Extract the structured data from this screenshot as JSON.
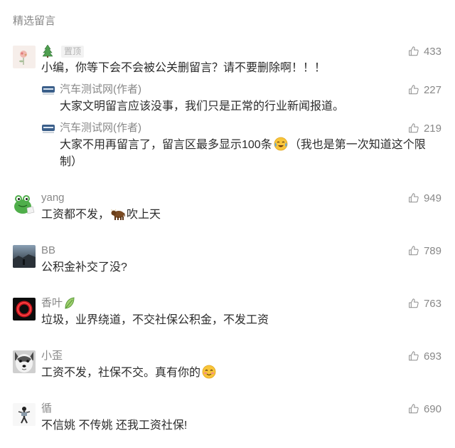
{
  "section_title": "精选留言",
  "icons": {
    "like": "thumbs-up-icon",
    "pinned_user_name": "evergreen-tree-icon",
    "name_decoration": "leaf-icon"
  },
  "colors": {
    "text": "#2b2b2b",
    "meta": "#888888",
    "badge_bg": "#f2f2f2",
    "badge_text": "#b2b2b2"
  },
  "comments": [
    {
      "name_icon": "evergreen-tree-icon",
      "badge": "置顶",
      "likes": 433,
      "text": "小编，你等下会不会被公关删留言？请不要删除啊！！！",
      "replies": [
        {
          "name": "汽车测试网(作者)",
          "likes": 227,
          "text": "大家文明留言应该没事，我们只是正常的行业新闻报道。"
        },
        {
          "name": "汽车测试网(作者)",
          "likes": 219,
          "text_before": "大家不用再留言了，留言区最多显示100条",
          "emoji": "crying-face-emoji-icon",
          "text_after": "（我也是第一次知道这个限制）"
        }
      ]
    },
    {
      "name": "yang",
      "likes": 949,
      "text_before": "工资都不发，",
      "emoji": "bull-emoji-icon",
      "text_after": "吹上天"
    },
    {
      "name": "BB",
      "likes": 789,
      "text": "公积金补交了没?"
    },
    {
      "name": "香叶",
      "name_icon": "leaf-icon",
      "likes": 763,
      "text": "垃圾，业界绕道，不交社保公积金，不发工资"
    },
    {
      "name": "小歪",
      "likes": 693,
      "text_before": "工资不发，社保不交。真有你的",
      "emoji": "smiling-blush-emoji-icon"
    },
    {
      "name": "循",
      "likes": 690,
      "text": "不信姚 不传姚 还我工资社保!"
    }
  ]
}
